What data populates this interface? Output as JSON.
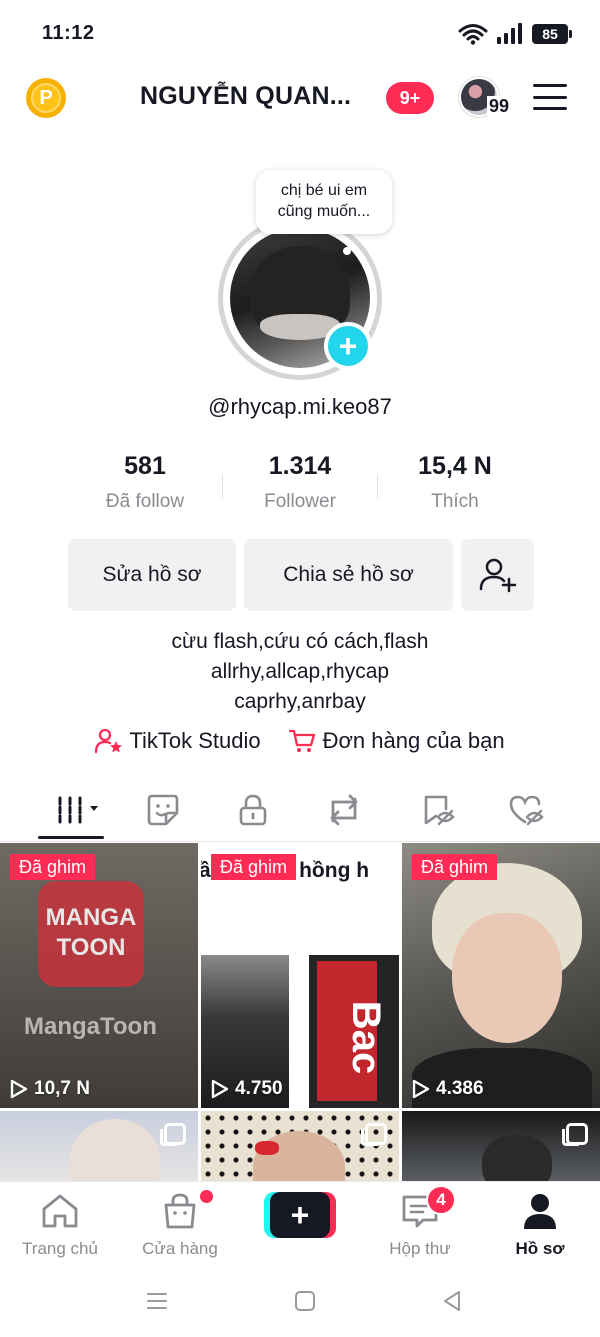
{
  "status_bar": {
    "time": "11:12",
    "battery": "85"
  },
  "header": {
    "title": "NGUYỄN QUAN...",
    "notification_badge": "9+",
    "friends_count": "99"
  },
  "profile": {
    "note": [
      "chị bé ui em",
      "cũng muốn..."
    ],
    "username": "@rhycap.mi.keo87",
    "stats": [
      {
        "value": "581",
        "label": "Đã follow"
      },
      {
        "value": "1.314",
        "label": "Follower"
      },
      {
        "value": "15,4 N",
        "label": "Thích"
      }
    ],
    "buttons": {
      "edit": "Sửa hồ sơ",
      "share": "Chia sẻ hồ sơ"
    },
    "bio": [
      "cừu flash,cứu có cách,flash",
      "allrhy,allcap,rhycap",
      "caprhy,anrbay"
    ],
    "links": {
      "studio": "TikTok Studio",
      "orders": "Đơn hàng của bạn"
    }
  },
  "videos": [
    {
      "pinned": "Đã ghim",
      "views": "10,7 N",
      "overlay": [
        "MANGA",
        "TOON",
        "MangaToon"
      ]
    },
    {
      "pinned": "Đã ghim",
      "views": "4.750",
      "caption": "ầu tối với hồng h",
      "sign": "Bac"
    },
    {
      "pinned": "Đã ghim",
      "views": "4.386"
    },
    {
      "multi": true
    },
    {
      "multi": true
    },
    {
      "multi": true
    }
  ],
  "bottom_nav": [
    {
      "label": "Trang chủ"
    },
    {
      "label": "Cửa hàng"
    },
    {
      "label": ""
    },
    {
      "label": "Hộp thư",
      "badge": "4"
    },
    {
      "label": "Hồ sơ"
    }
  ],
  "colors": {
    "accent": "#fe2c55",
    "cyan": "#25f4ee",
    "text": "#161823",
    "muted": "#8a8b91"
  }
}
